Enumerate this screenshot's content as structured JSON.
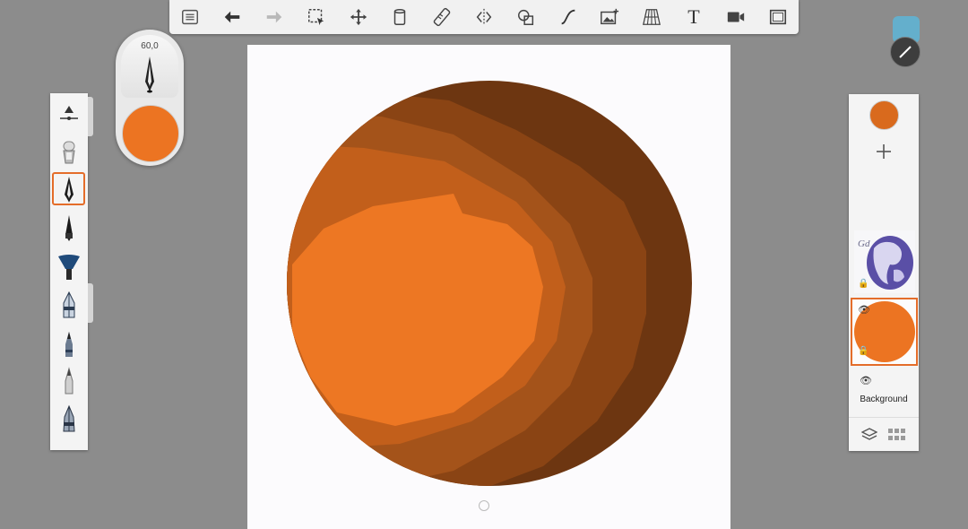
{
  "toolbar": {
    "tools": [
      {
        "name": "gallery-icon"
      },
      {
        "name": "undo-icon"
      },
      {
        "name": "redo-icon"
      },
      {
        "name": "selection-icon"
      },
      {
        "name": "transform-icon"
      },
      {
        "name": "fill-icon"
      },
      {
        "name": "ruler-icon"
      },
      {
        "name": "symmetry-icon"
      },
      {
        "name": "shape-icon"
      },
      {
        "name": "curve-icon"
      },
      {
        "name": "image-import-icon"
      },
      {
        "name": "perspective-grid-icon"
      },
      {
        "name": "text-icon",
        "label": "T"
      },
      {
        "name": "video-icon"
      },
      {
        "name": "fullscreen-icon"
      }
    ]
  },
  "brush_puck": {
    "size_label": "60,0",
    "current_color": "#ec7422"
  },
  "brush_library": {
    "active_index": 2,
    "brushes": [
      "size-slider-icon",
      "airbrush-icon",
      "ink-pen-icon",
      "fountain-pen-icon",
      "fan-brush-icon",
      "marker-icon",
      "pencil-icon",
      "hard-pencil-icon",
      "technical-pen-icon"
    ]
  },
  "layers": {
    "color_swatch": "#d96a1d",
    "items": [
      {
        "name": "globe-layer",
        "thumbnail": "globe"
      },
      {
        "name": "orange-circle-layer",
        "thumbnail": "orange-circle",
        "active": true
      },
      {
        "name": "background-layer",
        "label": "Background"
      }
    ]
  },
  "colors": {
    "accent": "#e46d2a",
    "shade_1": "#6d3611",
    "shade_2": "#8a4414",
    "shade_3": "#a4531a",
    "shade_4": "#c25f1b",
    "shade_5": "#ed7723"
  }
}
